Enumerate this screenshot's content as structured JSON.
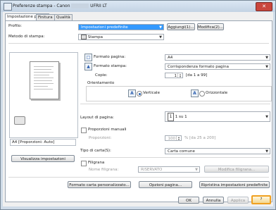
{
  "window": {
    "title": "Preferenze stampa - Canon",
    "title_suffix": "UFRII LT"
  },
  "tabs": [
    "Impostazione pagina",
    "Finitura",
    "Qualità"
  ],
  "profile": {
    "label": "Profilo:",
    "value": "Impostazioni predefinite",
    "add_label": "Aggiungi(1)...",
    "edit_label": "Modifica(2)..."
  },
  "method": {
    "label": "Metodo di stampa:",
    "value": "Stampa"
  },
  "preview_caption": "A4 [Proporzioni: Auto]",
  "view_settings_label": "Visualizza impostazioni",
  "page_size": {
    "label": "Formato pagina:",
    "value": "A4"
  },
  "output_size": {
    "label": "Formato stampa:",
    "value": "Corrispondenza formato pagina"
  },
  "copies": {
    "label": "Copie:",
    "value": "1",
    "range": "[da 1 a 99]"
  },
  "orientation": {
    "label": "Orientamento",
    "portrait": "Verticale",
    "landscape": "Orizzontale"
  },
  "page_layout": {
    "label": "Layout di pagina:",
    "value": "1 su 1"
  },
  "manual_scaling": {
    "label": "Proporzioni manuali",
    "sub_label": "Proporzioni:",
    "value": "100",
    "range": "% [da 25 a 200]"
  },
  "paper_type": {
    "label": "Tipo di carta(S):",
    "value": "Carta comune"
  },
  "watermark": {
    "label": "Filigrana",
    "name_label": "Nome filigrana:",
    "value": "RISERVATO",
    "edit_label": "Modifica filigrana..."
  },
  "bottom_buttons": {
    "custom_paper": "Formato carta personalizzato...",
    "page_options": "Opzioni pagina...",
    "restore": "Ripristina impostazioni predefinite"
  },
  "dialog_buttons": {
    "ok": "OK",
    "cancel": "Annulla",
    "apply": "Applica",
    "help": "?"
  },
  "icons": {
    "close": "close-icon",
    "printer": "printer-icon",
    "page": "page-size-icon",
    "output": "output-size-icon",
    "portrait": "portrait-icon",
    "landscape": "landscape-icon",
    "layout": "page-layout-icon",
    "preview_printer": "printer-preview-icon"
  }
}
